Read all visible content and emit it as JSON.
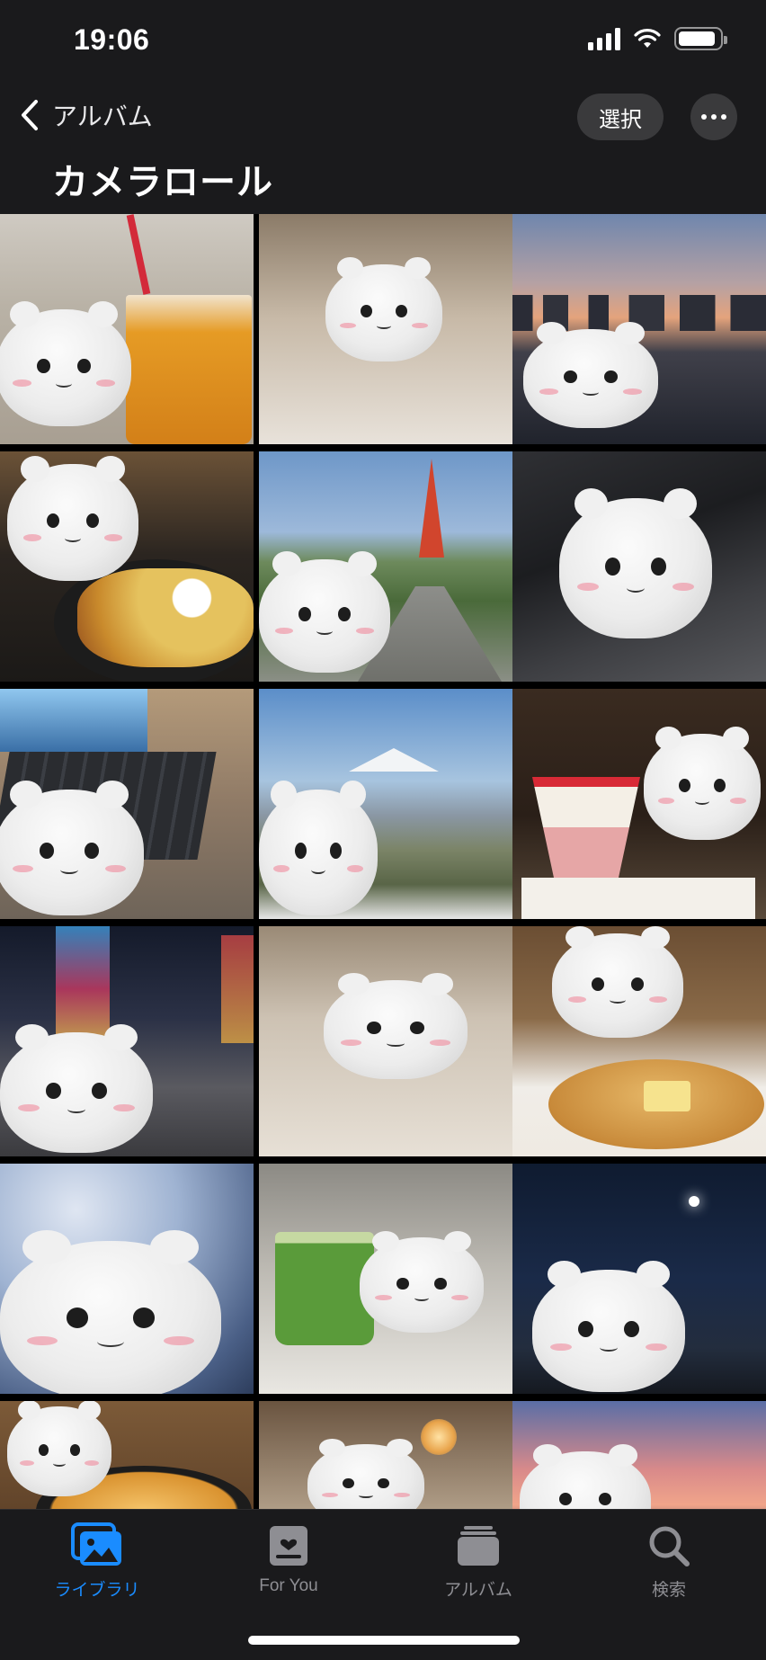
{
  "status_bar": {
    "time": "19:06"
  },
  "header": {
    "back_label": "アルバム",
    "select_label": "選択",
    "title": "カメラロール"
  },
  "tab_bar": {
    "tabs": [
      {
        "label": "ライブラリ",
        "icon": "photos-library-icon",
        "active": true
      },
      {
        "label": "For You",
        "icon": "for-you-icon",
        "active": false
      },
      {
        "label": "アルバム",
        "icon": "albums-icon",
        "active": false
      },
      {
        "label": "検索",
        "icon": "search-icon",
        "active": false
      }
    ]
  },
  "colors": {
    "accent": "#1a8cff",
    "inactive": "#8e8e93",
    "bar_background": "#1a1a1c"
  }
}
